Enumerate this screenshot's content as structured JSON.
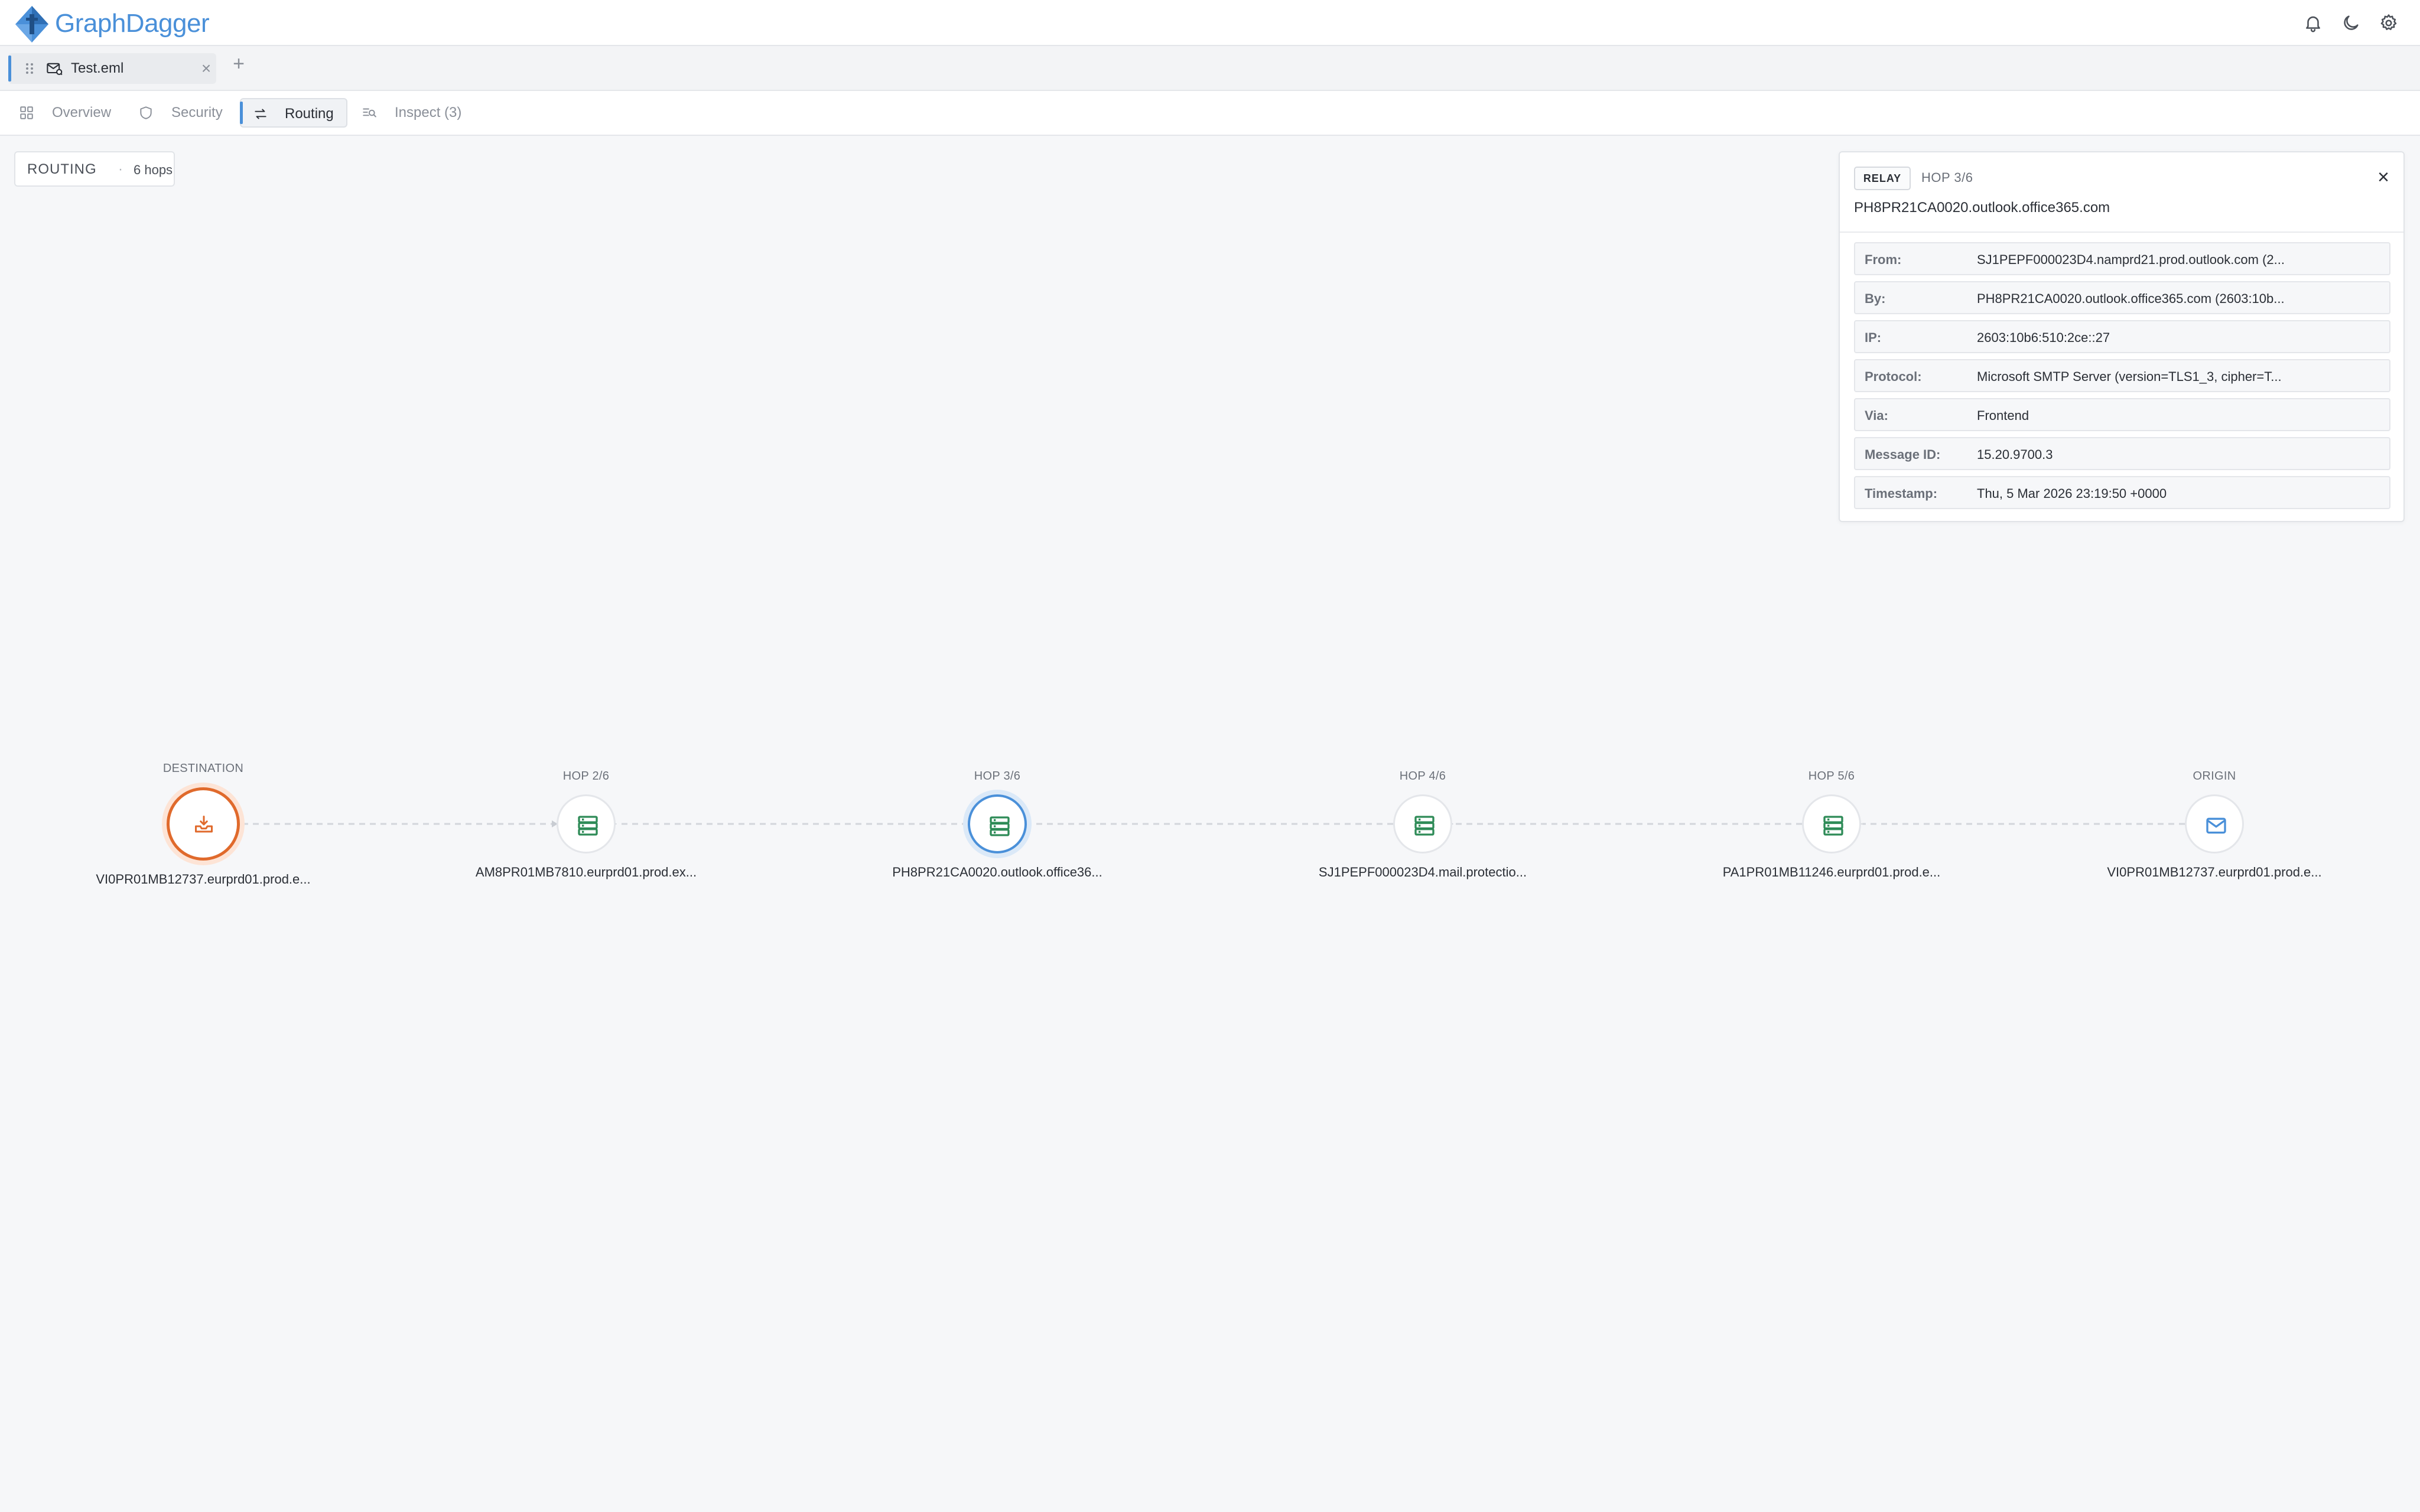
{
  "app": {
    "name": "GraphDagger",
    "icons": [
      "bell-icon",
      "moon-icon",
      "gear-icon"
    ]
  },
  "file_tab": {
    "label": "Test.eml",
    "close": "×",
    "add": "+"
  },
  "nav": {
    "tabs": [
      {
        "label": "Overview",
        "icon": "overview-icon",
        "active": false
      },
      {
        "label": "Security",
        "icon": "shield-icon",
        "active": false
      },
      {
        "label": "Routing",
        "icon": "routing-icon",
        "active": true
      },
      {
        "label": "Inspect (3)",
        "icon": "inspect-icon",
        "active": false
      }
    ]
  },
  "routing_badge": {
    "title": "ROUTING",
    "separator": "·",
    "count": "6 hops"
  },
  "panel": {
    "badge": "RELAY",
    "hop": "HOP 3/6",
    "host": "PH8PR21CA0020.outlook.office365.com",
    "close": "×",
    "rows": [
      {
        "key": "From:",
        "value": "SJ1PEPF000023D4.namprd21.prod.outlook.com (2..."
      },
      {
        "key": "By:",
        "value": "PH8PR21CA0020.outlook.office365.com (2603:10b..."
      },
      {
        "key": "IP:",
        "value": "2603:10b6:510:2ce::27"
      },
      {
        "key": "Protocol:",
        "value": "Microsoft SMTP Server (version=TLS1_3, cipher=T..."
      },
      {
        "key": "Via:",
        "value": "Frontend"
      },
      {
        "key": "Message ID:",
        "value": "15.20.9700.3"
      },
      {
        "key": "Timestamp:",
        "value": "Thu, 5 Mar 2026 23:19:50 +0000"
      }
    ]
  },
  "nodes": [
    {
      "label": "DESTINATION",
      "name": "VI0PR01MB12737.eurprd01.prod.e...",
      "kind": "destination",
      "icon": "inbox-download-icon"
    },
    {
      "label": "HOP 2/6",
      "name": "AM8PR01MB7810.eurprd01.prod.ex...",
      "kind": "server",
      "icon": "server-icon"
    },
    {
      "label": "HOP 3/6",
      "name": "PH8PR21CA0020.outlook.office36...",
      "kind": "server-selected",
      "icon": "server-icon"
    },
    {
      "label": "HOP 4/6",
      "name": "SJ1PEPF000023D4.mail.protectio...",
      "kind": "server",
      "icon": "server-icon"
    },
    {
      "label": "HOP 5/6",
      "name": "PA1PR01MB11246.eurprd01.prod.e...",
      "kind": "server",
      "icon": "server-icon"
    },
    {
      "label": "ORIGIN",
      "name": "VI0PR01MB12737.eurprd01.prod.e...",
      "kind": "origin",
      "icon": "mail-icon"
    }
  ],
  "colors": {
    "accent": "#4a90d9",
    "destination": "#e06a2c",
    "server": "#2e8b57",
    "origin": "#4a90d9"
  }
}
